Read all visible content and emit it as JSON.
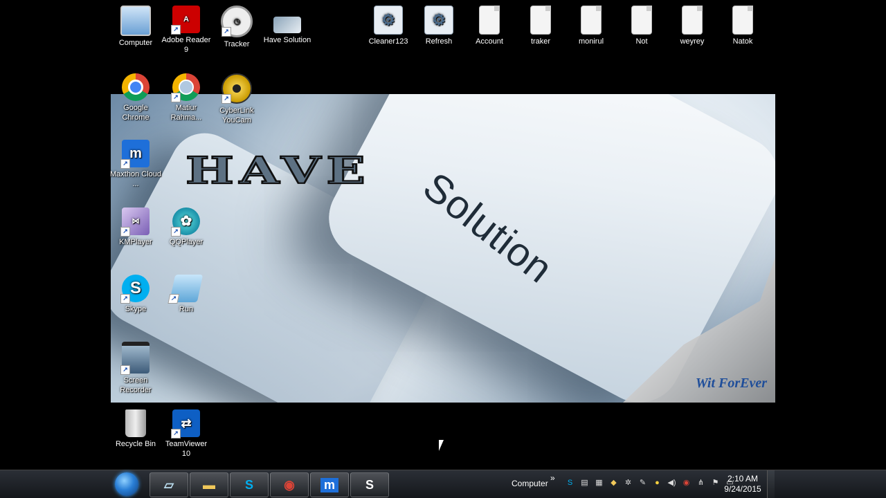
{
  "wallpaper": {
    "solution_text": "Solution",
    "have_text": "HAVE",
    "brand_text": "Wit ForEver"
  },
  "desktop_icons": {
    "computer": "Computer",
    "adobe_reader": "Adobe Reader 9",
    "tracker": "Tracker",
    "have_solution": "Have Solution",
    "cleaner123": "Cleaner123",
    "refresh": "Refresh",
    "account": "Account",
    "traker": "traker",
    "monirul": "monirul",
    "not": "Not",
    "weyrey": "weyrey",
    "natok": "Natok",
    "google_chrome": "Google Chrome",
    "matiur": "Matiur Rahma...",
    "cyberlink": "CyberLink YouCam",
    "maxthon": "Maxthon Cloud ...",
    "kmplayer": "KMPlayer",
    "qqplayer": "QQPlayer",
    "skype": "Skype",
    "run": "Run",
    "screen_recorder": "Screen Recorder",
    "recycle_bin": "Recycle Bin",
    "teamviewer": "TeamViewer 10"
  },
  "taskbar": {
    "toolbar_label": "Computer",
    "toolbar_chevron": "»",
    "clock_time": "2:10 AM",
    "clock_date": "9/24/2015"
  },
  "colors": {
    "chrome_red": "#db4437",
    "skype_blue": "#00aff0",
    "maxthon_blue": "#1e6fd9",
    "adobe_red": "#cc0000"
  }
}
